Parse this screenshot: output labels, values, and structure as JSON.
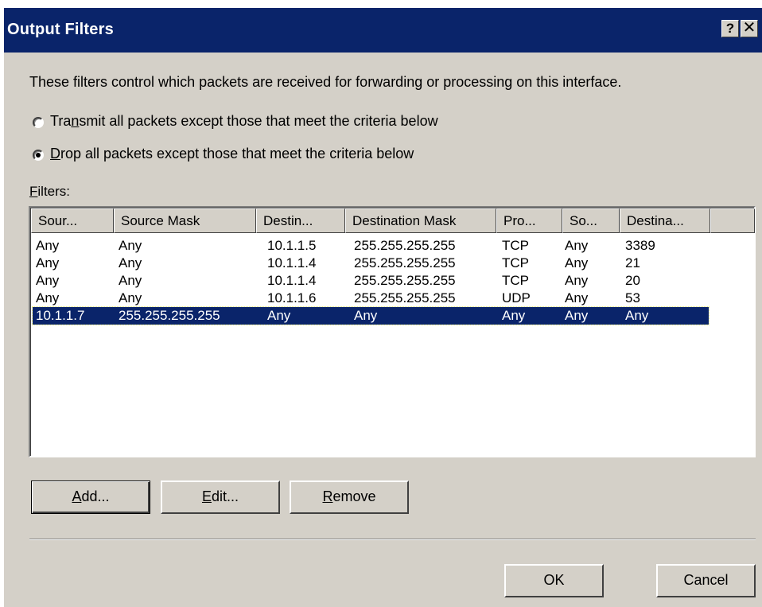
{
  "window": {
    "title": "Output Filters",
    "help_glyph": "?",
    "close_glyph": "✕",
    "colors": {
      "titlebar": "#0a246a",
      "face": "#d4d0c8",
      "selection": "#0a246a"
    }
  },
  "description": "These filters control which packets are received for forwarding or processing on this interface.",
  "options": {
    "transmit": {
      "pre": "Tra",
      "accel": "n",
      "post": "smit all packets except those that meet the criteria below",
      "selected": false
    },
    "drop": {
      "pre": "",
      "accel": "D",
      "post": "rop all packets except those that meet the criteria below",
      "selected": true
    }
  },
  "filters_label": {
    "accel": "F",
    "rest": "ilters:"
  },
  "table": {
    "columns": [
      "Sour...",
      "Source Mask",
      "Destin...",
      "Destination Mask",
      "Pro...",
      "So...",
      "Destina..."
    ],
    "rows": [
      [
        "Any",
        "Any",
        "10.1.1.5",
        "255.255.255.255",
        "TCP",
        "Any",
        "3389"
      ],
      [
        "Any",
        "Any",
        "10.1.1.4",
        "255.255.255.255",
        "TCP",
        "Any",
        "21"
      ],
      [
        "Any",
        "Any",
        "10.1.1.4",
        "255.255.255.255",
        "TCP",
        "Any",
        "20"
      ],
      [
        "Any",
        "Any",
        "10.1.1.6",
        "255.255.255.255",
        "UDP",
        "Any",
        "53"
      ],
      [
        "10.1.1.7",
        "255.255.255.255",
        "Any",
        "Any",
        "Any",
        "Any",
        "Any"
      ]
    ],
    "selected_row": 4
  },
  "buttons": {
    "add": {
      "accel": "A",
      "rest": "dd..."
    },
    "edit": {
      "accel": "E",
      "rest": "dit..."
    },
    "remove": {
      "accel": "R",
      "rest": "emove"
    },
    "ok": "OK",
    "cancel": "Cancel"
  }
}
